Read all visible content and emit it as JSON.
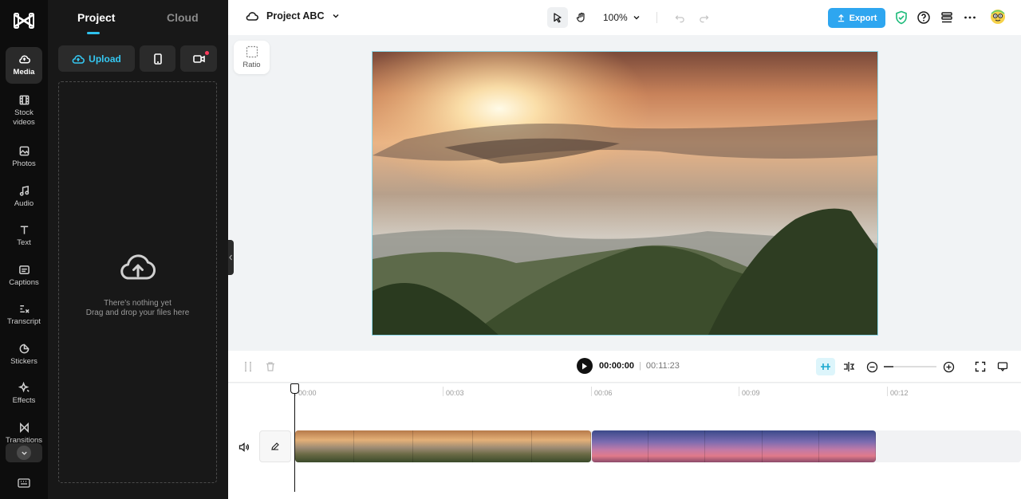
{
  "rail": {
    "items": [
      {
        "label": "Media"
      },
      {
        "label": "Stock videos"
      },
      {
        "label": "Photos"
      },
      {
        "label": "Audio"
      },
      {
        "label": "Text"
      },
      {
        "label": "Captions"
      },
      {
        "label": "Transcript"
      },
      {
        "label": "Stickers"
      },
      {
        "label": "Effects"
      },
      {
        "label": "Transitions"
      }
    ]
  },
  "panel": {
    "tabs": [
      {
        "label": "Project"
      },
      {
        "label": "Cloud"
      }
    ],
    "upload_label": "Upload",
    "empty_line1": "There's nothing yet",
    "empty_line2": "Drag and drop your files here"
  },
  "topbar": {
    "project_name": "Project ABC",
    "zoom": "100%",
    "export_label": "Export"
  },
  "canvas": {
    "ratio_label": "Ratio"
  },
  "timeline": {
    "current_time": "00:00:00",
    "total_time": "00:11:23",
    "ruler": [
      "00:00",
      "00:03",
      "00:06",
      "00:09",
      "00:12"
    ]
  },
  "colors": {
    "accent": "#2fc2ee",
    "export": "#2ea6f0"
  }
}
